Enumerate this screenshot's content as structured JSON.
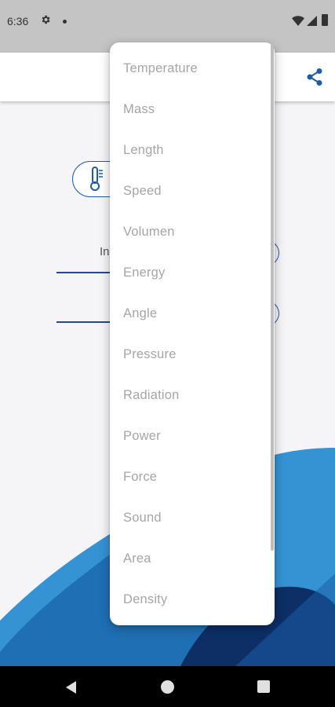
{
  "status_bar": {
    "time": "6:36",
    "icons": [
      "settings-icon",
      "notification-dot-icon",
      "wifi-icon",
      "cellular-signal-icon",
      "battery-icon"
    ]
  },
  "app_bar": {
    "actions": [
      "share-icon"
    ]
  },
  "category_chip": {
    "icon": "thermometer-icon"
  },
  "input": {
    "label_fragment": "In"
  },
  "dropdown": {
    "items": [
      "Temperature",
      "Mass",
      "Length",
      "Speed",
      "Volumen",
      "Energy",
      "Angle",
      "Pressure",
      "Radiation",
      "Power",
      "Force",
      "Sound",
      "Area",
      "Density"
    ]
  },
  "nav_bar": {
    "buttons": [
      "back-icon",
      "home-icon",
      "recents-icon"
    ]
  },
  "colors": {
    "accent": "#1e5aa6",
    "wave_light": "#3592d3",
    "wave_mid": "#1f6fb5",
    "wave_dark": "#0d2f66",
    "menu_text": "#a5a5a5"
  }
}
